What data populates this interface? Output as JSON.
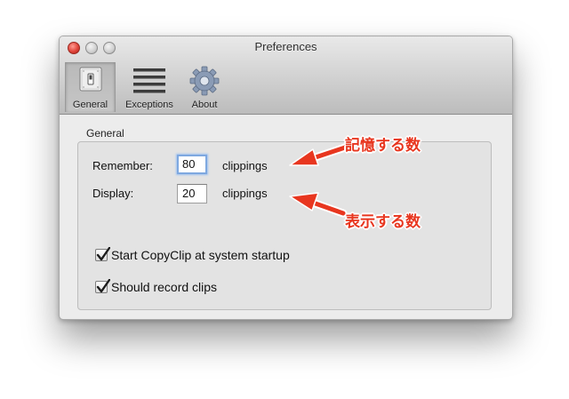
{
  "window": {
    "title": "Preferences"
  },
  "toolbar": {
    "items": [
      {
        "label": "General",
        "icon": "switch-icon",
        "selected": true
      },
      {
        "label": "Exceptions",
        "icon": "list-icon",
        "selected": false
      },
      {
        "label": "About",
        "icon": "gear-icon",
        "selected": false
      }
    ]
  },
  "general": {
    "group_title": "General",
    "remember": {
      "label": "Remember:",
      "value": "80",
      "unit": "clippings"
    },
    "display": {
      "label": "Display:",
      "value": "20",
      "unit": "clippings"
    },
    "options": [
      {
        "label": "Start CopyClip at system startup",
        "checked": true
      },
      {
        "label": "Should record clips",
        "checked": true
      }
    ]
  },
  "annotations": {
    "remember_note": "記憶する数",
    "display_note": "表示する数",
    "color": "#e8361f"
  }
}
